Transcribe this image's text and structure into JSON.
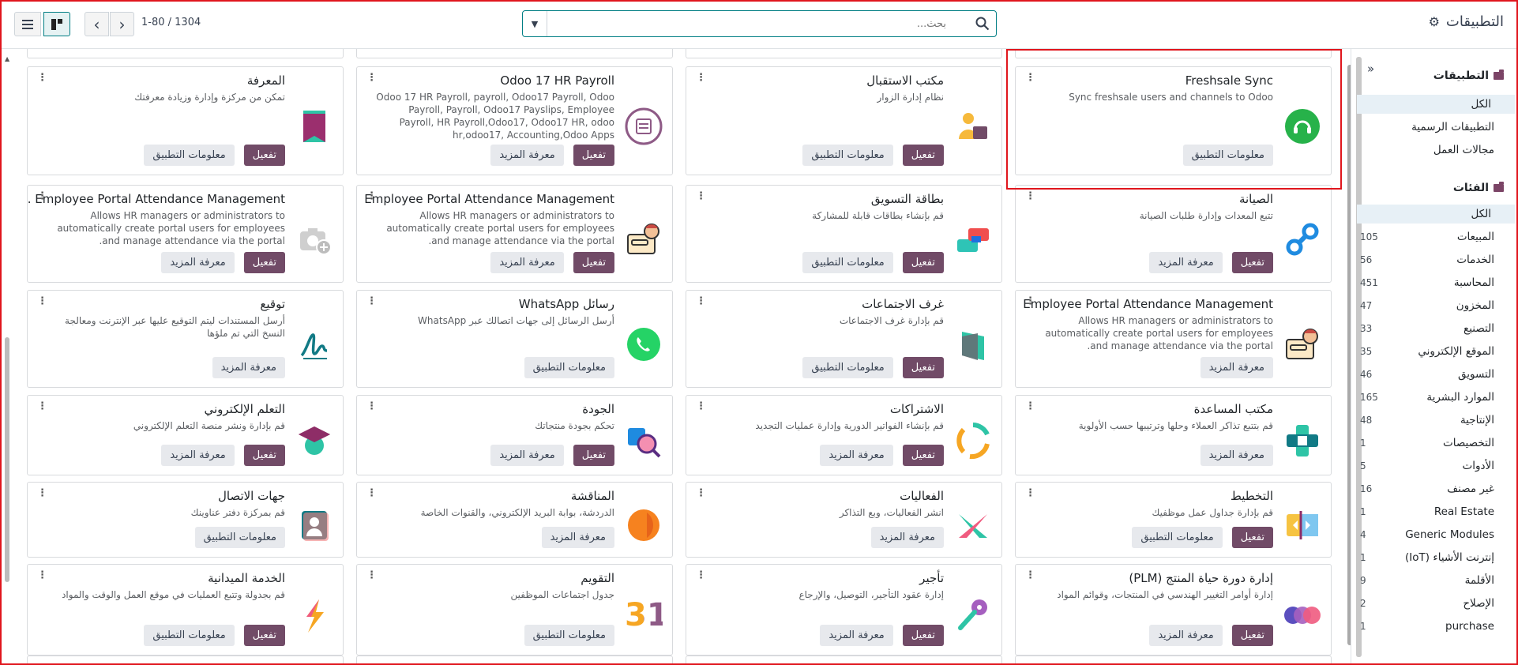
{
  "topbar": {
    "breadcrumb": "التطبيقات",
    "search_placeholder": "بحث...",
    "pager": "1-80 / 1304"
  },
  "sidebar": {
    "apps_header": "التطبيقات",
    "apps_items": [
      {
        "label": "الكل",
        "active": true
      },
      {
        "label": "التطبيقات الرسمية"
      },
      {
        "label": "مجالات العمل"
      }
    ],
    "categories_header": "الفئات",
    "categories": [
      {
        "label": "الكل",
        "count": "",
        "active": true
      },
      {
        "label": "المبيعات",
        "count": "105"
      },
      {
        "label": "الخدمات",
        "count": "56"
      },
      {
        "label": "المحاسبة",
        "count": "451"
      },
      {
        "label": "المخزون",
        "count": "47"
      },
      {
        "label": "التصنيع",
        "count": "33"
      },
      {
        "label": "الموقع الإلكتروني",
        "count": "35"
      },
      {
        "label": "التسويق",
        "count": "46"
      },
      {
        "label": "الموارد البشرية",
        "count": "165"
      },
      {
        "label": "الإنتاجية",
        "count": "48"
      },
      {
        "label": "التخصيصات",
        "count": "1"
      },
      {
        "label": "الأدوات",
        "count": "5"
      },
      {
        "label": "غير مصنف",
        "count": "16"
      },
      {
        "label": "Real Estate",
        "count": "1"
      },
      {
        "label": "Generic Modules",
        "count": "4"
      },
      {
        "label": "إنترنت الأشياء (IoT)",
        "count": "1"
      },
      {
        "label": "الأقلمة",
        "count": "9"
      },
      {
        "label": "الإصلاح",
        "count": "2"
      },
      {
        "label": "purchase",
        "count": "1"
      }
    ]
  },
  "labels": {
    "activate": "تفعيل",
    "app_info": "معلومات التطبيق",
    "learn_more": "معرفة المزيد"
  },
  "cards": [
    {
      "title": "Freshsale Sync",
      "desc": "Sync freshsale users and channels to Odoo",
      "icon": "freshsale-icon",
      "buttons": [
        "app_info"
      ]
    },
    {
      "title": "مكتب الاستقبال",
      "desc": "نظام إدارة الزوار",
      "icon": "frontdesk-icon",
      "buttons": [
        "activate",
        "app_info"
      ]
    },
    {
      "title": "Odoo 17 HR Payroll",
      "desc": "Odoo 17 HR Payroll, payroll, Odoo17 Payroll, Odoo Payroll, Payroll, Odoo17 Payslips, Employee Payroll, HR Payroll,Odoo17, Odoo17 HR, odoo hr,odoo17, Accounting,Odoo Apps",
      "icon": "payroll-icon",
      "buttons": [
        "activate",
        "learn_more"
      ]
    },
    {
      "title": "المعرفة",
      "desc": "تمكن من مركزة وإدارة وزيادة معرفتك",
      "icon": "knowledge-icon",
      "buttons": [
        "activate",
        "app_info"
      ]
    },
    {
      "title": "الصيانة",
      "desc": "تتبع المعدات وإدارة طلبات الصيانة",
      "icon": "maintenance-icon",
      "buttons": [
        "activate",
        "learn_more"
      ]
    },
    {
      "title": "بطاقة التسويق",
      "desc": "قم بإنشاء بطاقات قابلة للمشاركة",
      "icon": "marketing-card-icon",
      "buttons": [
        "activate",
        "app_info"
      ]
    },
    {
      "title": "Employee Portal Attendance Management",
      "desc": "Allows HR managers or administrators to automatically create portal users for employees and manage attendance via the portal.",
      "icon": "portal-attendance-icon",
      "buttons": [
        "activate",
        "learn_more"
      ]
    },
    {
      "title": "Employee Portal Attendance Management .",
      "desc": "Allows HR managers or administrators to automatically create portal users for employees and manage attendance via the portal.",
      "icon": "camera-placeholder-icon",
      "buttons": [
        "activate",
        "learn_more"
      ]
    },
    {
      "title": "Employee Portal Attendance Management",
      "desc": "Allows HR managers or administrators to automatically create portal users for employees and manage attendance via the portal.",
      "icon": "portal-attendance-icon",
      "buttons": [
        "learn_more"
      ]
    },
    {
      "title": "غرف الاجتماعات",
      "desc": "قم بإدارة غرف الاجتماعات",
      "icon": "meeting-rooms-icon",
      "buttons": [
        "activate",
        "app_info"
      ]
    },
    {
      "title": "رسائل WhatsApp",
      "desc": "أرسل الرسائل إلى جهات اتصالك عبر WhatsApp",
      "icon": "whatsapp-icon",
      "buttons": [
        "app_info"
      ]
    },
    {
      "title": "توقيع",
      "desc": "أرسل المستندات ليتم التوقيع عليها عبر الإنترنت ومعالجة النسخ التي تم ملؤها",
      "icon": "sign-icon",
      "buttons": [
        "learn_more"
      ]
    },
    {
      "title": "مكتب المساعدة",
      "desc": "قم بتتبع تذاكر العملاء وحلها وترتيبها حسب الأولوية",
      "icon": "helpdesk-icon",
      "buttons": [
        "learn_more"
      ]
    },
    {
      "title": "الاشتراكات",
      "desc": "قم بإنشاء الفواتير الدورية وإدارة عمليات التجديد",
      "icon": "subscriptions-icon",
      "buttons": [
        "activate",
        "learn_more"
      ]
    },
    {
      "title": "الجودة",
      "desc": "تحكم بجودة منتجاتك",
      "icon": "quality-icon",
      "buttons": [
        "activate",
        "learn_more"
      ]
    },
    {
      "title": "التعلم الإلكتروني",
      "desc": "قم بإدارة ونشر منصة التعلم الإلكتروني",
      "icon": "elearning-icon",
      "buttons": [
        "activate",
        "learn_more"
      ]
    },
    {
      "title": "التخطيط",
      "desc": "قم بإدارة جداول عمل موظفيك",
      "icon": "planning-icon",
      "buttons": [
        "activate",
        "app_info"
      ]
    },
    {
      "title": "الفعاليات",
      "desc": "انشر الفعاليات، وبع التذاكر",
      "icon": "events-icon",
      "buttons": [
        "learn_more"
      ]
    },
    {
      "title": "المناقشة",
      "desc": "الدردشة، بوابة البريد الإلكتروني، والقنوات الخاصة",
      "icon": "discuss-icon",
      "buttons": [
        "learn_more"
      ]
    },
    {
      "title": "جهات الاتصال",
      "desc": "قم بمركزة دفتر عناوينك",
      "icon": "contacts-icon",
      "buttons": [
        "app_info"
      ]
    },
    {
      "title": "إدارة دورة حياة المنتج (PLM)",
      "desc": "إدارة أوامر التغيير الهندسي في المنتجات، وقوائم المواد",
      "icon": "plm-icon",
      "buttons": [
        "activate",
        "learn_more"
      ]
    },
    {
      "title": "تأجير",
      "desc": "إدارة عقود التأجير، التوصيل، والإرجاع",
      "icon": "rental-icon",
      "buttons": [
        "activate",
        "learn_more"
      ]
    },
    {
      "title": "التقويم",
      "desc": "جدول اجتماعات الموظفين",
      "icon": "calendar-icon",
      "calendar_day": "31",
      "buttons": [
        "app_info"
      ]
    },
    {
      "title": "الخدمة الميدانية",
      "desc": "قم بجدولة وتتبع العمليات في موقع العمل والوقت والمواد",
      "icon": "field-service-icon",
      "buttons": [
        "activate",
        "app_info"
      ]
    }
  ],
  "colors": {
    "primary": "#714b67",
    "accent": "#017e84",
    "highlight": "#e0161d"
  }
}
